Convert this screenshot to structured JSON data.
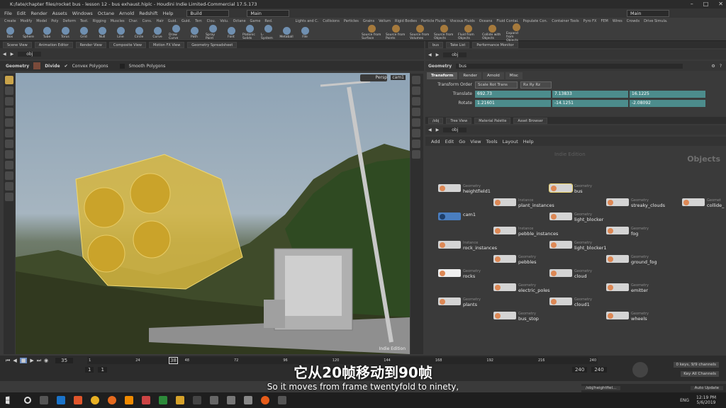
{
  "window": {
    "title": "K:/late/chapter files/rocket bus - lesson 12 - bus exhaust.hiplc - Houdini Indie Limited-Commercial 17.5.173"
  },
  "menubar": {
    "items": [
      "File",
      "Edit",
      "Render",
      "Assets",
      "Windows",
      "Octane",
      "Arnold",
      "Redshift",
      "Help"
    ],
    "desktop_left": "Build",
    "desktop_center": "Main",
    "desktop_right": "Main"
  },
  "shelf": {
    "tabs": [
      "Create",
      "Modify",
      "Model",
      "Poly",
      "Deform",
      "Text.",
      "Rigging",
      "Muscles",
      "Char.",
      "Cons.",
      "Hair",
      "Guid.",
      "Guid.",
      "Terr.",
      "Clou.",
      "Volu.",
      "Octane",
      "Game",
      "Red."
    ],
    "tools": [
      "Box",
      "Sphere",
      "Tube",
      "Torus",
      "Grid",
      "Null",
      "Line",
      "Circle",
      "Curve",
      "Draw Curve",
      "Path",
      "Spray Paint",
      "Font",
      "Platonic Solids",
      "L-System",
      "Metaball",
      "File"
    ],
    "right_tabs": [
      "Lights and C.",
      "Collisions",
      "Particles",
      "Grains",
      "Vellum",
      "Rigid Bodies",
      "Particle Fluids",
      "Viscous Fluids",
      "Oceans",
      "Fluid Contai.",
      "Populate Con.",
      "Container Tools",
      "Pyro FX",
      "FEM",
      "Wires",
      "Crowds",
      "Drive Simula."
    ],
    "right_tools": [
      "Source from Surface",
      "Source from Points",
      "Source from Volumes",
      "Source from Objects",
      "Fluid from Objects",
      "Collide with Objects",
      "Expand from Objects"
    ]
  },
  "left_panel": {
    "tabs": [
      "Scene View",
      "Animation Editor",
      "Render View",
      "Composite View",
      "Motion FX View",
      "Geometry Spreadsheet"
    ],
    "path": "obj",
    "toolbar": {
      "context": "Geometry",
      "divide_label": "Divide",
      "convex_label": "Convex Polygons",
      "smooth_label": "Smooth Polygons"
    },
    "viewport": {
      "camera": "Persp",
      "cam_select": "cam1",
      "watermark": "Indie Edition"
    }
  },
  "timeline": {
    "current_frame": "35",
    "start_frame": "1",
    "start_frame2": "1",
    "end_frame": "240",
    "end_frame2": "240",
    "marker": "38",
    "ticks": [
      "1",
      "24",
      "48",
      "72",
      "96",
      "120",
      "144",
      "168",
      "192",
      "216",
      "240"
    ],
    "keys_info": "0 keys, 9/9 channels",
    "key_all": "Key All Channels",
    "path": "/obj/heightfiel...",
    "auto_update": "Auto Update"
  },
  "right_panel": {
    "tabs": [
      "bus",
      "Take List",
      "Performance Monitor"
    ],
    "path": "obj",
    "param_header": {
      "type": "Geometry",
      "name": "bus"
    },
    "param_tabs": [
      "Transform",
      "Render",
      "Arnold",
      "Misc"
    ],
    "transform_order": {
      "label": "Transform Order",
      "value1": "Scale Rot Trans",
      "value2": "Rx Ry Rz"
    },
    "translate": {
      "label": "Translate",
      "x": "692.73",
      "y": "7.13833",
      "z": "16.1225"
    },
    "rotate": {
      "label": "Rotate",
      "x": "1.21601",
      "y": "-14.1251",
      "z": "-2.08092"
    }
  },
  "network": {
    "tabs": [
      "/obj",
      "Tree View",
      "Material Palette",
      "Asset Browser"
    ],
    "path": "obj",
    "menu": [
      "Add",
      "Edit",
      "Go",
      "View",
      "Tools",
      "Layout",
      "Help"
    ],
    "watermark": "Objects",
    "indie": "Indie Edition",
    "nodes": [
      {
        "type": "Geometry",
        "name": "heightfield1"
      },
      {
        "type": "Geometry",
        "name": "bus"
      },
      {
        "type": "Instance",
        "name": "plant_instances"
      },
      {
        "type": "Geometry",
        "name": "streaky_clouds"
      },
      {
        "type": "Geomet",
        "name": "collide_"
      },
      {
        "type": "",
        "name": "cam1"
      },
      {
        "type": "Geometry",
        "name": "light_blocker"
      },
      {
        "type": "Instance",
        "name": "pebble_instances"
      },
      {
        "type": "Geometry",
        "name": "fog"
      },
      {
        "type": "Instance",
        "name": "rock_instances"
      },
      {
        "type": "Geometry",
        "name": "light_blocker1"
      },
      {
        "type": "Geometry",
        "name": "pebbles"
      },
      {
        "type": "Geometry",
        "name": "ground_fog"
      },
      {
        "type": "Geometry",
        "name": "rocks"
      },
      {
        "type": "Geometry",
        "name": "cloud"
      },
      {
        "type": "Geometry",
        "name": "electric_poles"
      },
      {
        "type": "Geometry",
        "name": "emitter"
      },
      {
        "type": "Geometry",
        "name": "plants"
      },
      {
        "type": "Geometry",
        "name": "cloud1"
      },
      {
        "type": "Geometry",
        "name": "bus_stop"
      },
      {
        "type": "Geometry",
        "name": "wheels"
      }
    ]
  },
  "subtitles": {
    "chinese": "它从20帧移动到90帧",
    "english": "So it moves from frame twentyfold to ninety,"
  },
  "taskbar": {
    "time": "12:19 PM",
    "date": "5/6/2019",
    "lang": "ENG"
  }
}
